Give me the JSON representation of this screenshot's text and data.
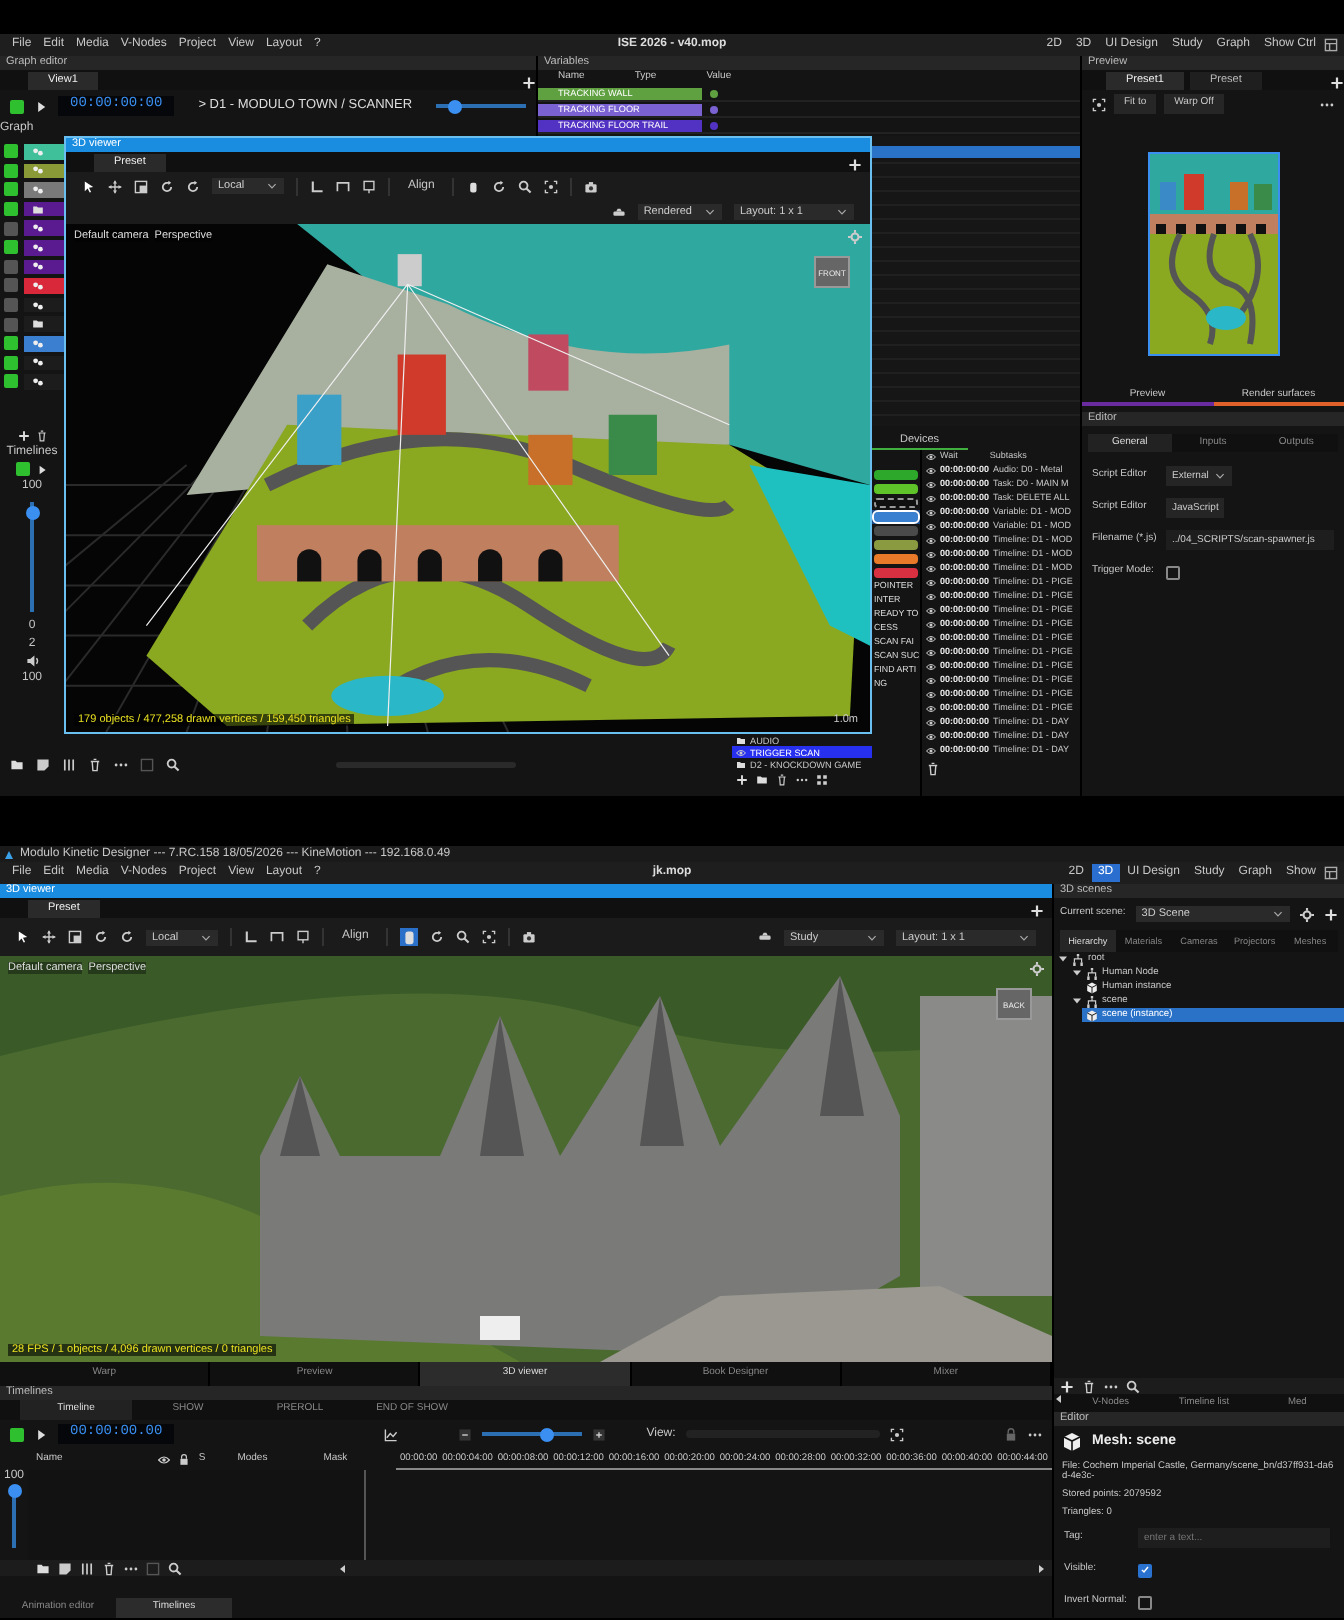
{
  "top": {
    "menu": [
      "File",
      "Edit",
      "Media",
      "V-Nodes",
      "Project",
      "View",
      "Layout",
      "?"
    ],
    "title": "ISE 2026 - v40.mop",
    "workspaces": [
      {
        "label": "2D",
        "selected": false
      },
      {
        "label": "3D",
        "selected": false
      },
      {
        "label": "UI Design",
        "selected": false
      },
      {
        "label": "Study",
        "selected": false
      },
      {
        "label": "Graph",
        "selected": false
      },
      {
        "label": "Show Ctrl",
        "selected": false
      }
    ],
    "graph_editor": {
      "title": "Graph editor",
      "tab": "View1",
      "timecode": "00:00:00:00",
      "path": "> D1 - MODULO TOWN / SCANNER",
      "zoom": {
        "level": 0.2
      },
      "label": "Graph",
      "rows": [
        {
          "kind": "node",
          "on": true,
          "color": "#3fbf9a"
        },
        {
          "kind": "node",
          "on": true,
          "color": "#8a9a36"
        },
        {
          "kind": "node",
          "on": true,
          "color": "#7a7a7a"
        },
        {
          "kind": "folder",
          "on": true,
          "color": "#5a1a90"
        },
        {
          "kind": "node",
          "on": false,
          "color": "#5a1a90"
        },
        {
          "kind": "node",
          "on": true,
          "color": "#5a1a90"
        },
        {
          "kind": "node",
          "on": false,
          "color": "#5a1a90"
        },
        {
          "kind": "node",
          "on": false,
          "color": "#d8283a"
        },
        {
          "kind": "node",
          "on": false,
          "color": "#1c1c1c"
        },
        {
          "kind": "folder",
          "on": false,
          "color": "#1c1c1c"
        },
        {
          "kind": "node",
          "on": true,
          "color": "#3a7fd0"
        },
        {
          "kind": "node",
          "on": true,
          "color": "#1c1c1c"
        },
        {
          "kind": "node",
          "on": true,
          "color": "#1c1c1c"
        }
      ]
    },
    "variables": {
      "title": "Variables",
      "columns": [
        "Name",
        "Type",
        "Value"
      ],
      "rows": [
        {
          "name": "TRACKING WALL",
          "color": "#5fa040"
        },
        {
          "name": "TRACKING FLOOR",
          "color": "#7a62d2"
        },
        {
          "name": "TRACKING FLOOR TRAIL",
          "color": "#5232c2"
        }
      ]
    },
    "viewer": {
      "title": "3D viewer",
      "tab": "Preset",
      "space": "Local",
      "align": "Align",
      "render_mode": "Rendered",
      "layout": "Layout: 1 x 1",
      "camera": "Default camera",
      "projection": "Perspective",
      "stats": "179 objects / 477,258 drawn vertices / 159,450 triangles",
      "scale": "1.0m",
      "gizmo": "FRONT"
    },
    "timelines": {
      "title": "Timelines",
      "volume": {
        "level": 0.9
      },
      "top_reading": "100",
      "readings": [
        "0",
        "2"
      ],
      "bottom_reading": "100"
    },
    "devices": {
      "tab": "Devices",
      "columns": [
        "Wait",
        "Subtasks"
      ],
      "tasks": [
        {
          "kind": "bar",
          "color": "#2ea82a",
          "selected": false
        },
        {
          "kind": "bar",
          "color": "#5ec42a",
          "selected": false
        },
        {
          "kind": "bar",
          "color": "#101010",
          "selected": false
        },
        {
          "kind": "bar",
          "color": "#3a80d0",
          "selected": true
        },
        {
          "kind": "bar",
          "color": "#4a4a4a",
          "selected": false
        },
        {
          "kind": "bar",
          "color": "#8a9a40",
          "selected": false
        },
        {
          "kind": "bar",
          "color": "#e87a2a",
          "selected": false
        },
        {
          "kind": "bar",
          "color": "#d83040",
          "selected": false
        },
        {
          "kind": "text",
          "label": "POINTER",
          "selected": false
        },
        {
          "kind": "text",
          "label": "INTER",
          "selected": false
        },
        {
          "kind": "text",
          "label": "READY TO",
          "selected": false
        },
        {
          "kind": "text",
          "label": "CESS",
          "selected": false
        },
        {
          "kind": "text",
          "label": "SCAN FAI",
          "selected": false
        },
        {
          "kind": "text",
          "label": "SCAN SUC",
          "selected": false
        },
        {
          "kind": "text",
          "label": "FIND ARTI",
          "selected": false
        },
        {
          "kind": "text",
          "label": "NG",
          "selected": false
        }
      ],
      "folders": [
        {
          "label": "AUDIO",
          "kind": "folder",
          "selected": false
        },
        {
          "label": "TRIGGER SCAN",
          "kind": "item",
          "selected": true
        },
        {
          "label": "D2 - KNOCKDOWN GAME",
          "kind": "folder",
          "selected": false
        }
      ],
      "subtasks": [
        {
          "wait": "00:00:00:00",
          "text": "Audio: D0 - Metal"
        },
        {
          "wait": "00:00:00:00",
          "text": "Task: D0 - MAIN M"
        },
        {
          "wait": "00:00:00:00",
          "text": "Task: DELETE ALL"
        },
        {
          "wait": "00:00:00:00",
          "text": "Variable: D1 - MOD"
        },
        {
          "wait": "00:00:00:00",
          "text": "Variable: D1 - MOD"
        },
        {
          "wait": "00:00:00:00",
          "text": "Timeline: D1 - MOD"
        },
        {
          "wait": "00:00:00:00",
          "text": "Timeline: D1 - MOD"
        },
        {
          "wait": "00:00:00:00",
          "text": "Timeline: D1 - MOD"
        },
        {
          "wait": "00:00:00:00",
          "text": "Timeline: D1 - PIGE"
        },
        {
          "wait": "00:00:00:00",
          "text": "Timeline: D1 - PIGE"
        },
        {
          "wait": "00:00:00:00",
          "text": "Timeline: D1 - PIGE"
        },
        {
          "wait": "00:00:00:00",
          "text": "Timeline: D1 - PIGE"
        },
        {
          "wait": "00:00:00:00",
          "text": "Timeline: D1 - PIGE"
        },
        {
          "wait": "00:00:00:00",
          "text": "Timeline: D1 - PIGE"
        },
        {
          "wait": "00:00:00:00",
          "text": "Timeline: D1 - PIGE"
        },
        {
          "wait": "00:00:00:00",
          "text": "Timeline: D1 - PIGE"
        },
        {
          "wait": "00:00:00:00",
          "text": "Timeline: D1 - PIGE"
        },
        {
          "wait": "00:00:00:00",
          "text": "Timeline: D1 - PIGE"
        },
        {
          "wait": "00:00:00:00",
          "text": "Timeline: D1 - DAY"
        },
        {
          "wait": "00:00:00:00",
          "text": "Timeline: D1 - DAY"
        },
        {
          "wait": "00:00:00:00",
          "text": "Timeline: D1 - DAY"
        }
      ]
    },
    "preview": {
      "title": "Preview",
      "tabs": [
        {
          "label": "Preset1",
          "selected": true
        },
        {
          "label": "Preset",
          "selected": false
        }
      ],
      "buttons": [
        "Fit to",
        "Warp Off"
      ],
      "views": [
        {
          "label": "Preview",
          "color": "#6a2aa0"
        },
        {
          "label": "Render surfaces",
          "color": "#e0602a"
        }
      ]
    },
    "editor": {
      "title": "Editor",
      "tabs": [
        {
          "label": "General",
          "selected": true
        },
        {
          "label": "Inputs",
          "selected": false
        },
        {
          "label": "Outputs",
          "selected": false
        }
      ],
      "fields": [
        {
          "kind": "dropdown",
          "label": "Script Editor",
          "value": "External"
        },
        {
          "kind": "button",
          "label": "Script Editor",
          "value": "JavaScript"
        },
        {
          "kind": "text",
          "label": "Filename (*.js)",
          "value": "../04_SCRIPTS/scan-spawner.js"
        },
        {
          "kind": "checkbox",
          "label": "Trigger Mode:",
          "checked": false
        }
      ]
    }
  },
  "bottom": {
    "app_title": "Modulo Kinetic Designer --- 7.RC.158 18/05/2026 --- KineMotion --- 192.168.0.49",
    "menu": [
      "File",
      "Edit",
      "Media",
      "V-Nodes",
      "Project",
      "View",
      "Layout",
      "?"
    ],
    "title": "jk.mop",
    "workspaces": [
      {
        "label": "2D",
        "selected": false
      },
      {
        "label": "3D",
        "selected": true
      },
      {
        "label": "UI Design",
        "selected": false
      },
      {
        "label": "Study",
        "selected": false
      },
      {
        "label": "Graph",
        "selected": false
      },
      {
        "label": "Show",
        "selected": false
      }
    ],
    "viewer": {
      "title": "3D viewer",
      "tab": "Preset",
      "space": "Local",
      "align": "Align",
      "render_mode": "Study",
      "layout": "Layout: 1 x 1",
      "camera": "Default camera",
      "projection": "Perspective",
      "stats": "28 FPS / 1 objects / 4,096 drawn vertices / 0 triangles",
      "gizmo": "BACK"
    },
    "panel_tabs": [
      {
        "label": "Warp",
        "selected": false
      },
      {
        "label": "Preview",
        "selected": false
      },
      {
        "label": "3D viewer",
        "selected": true
      },
      {
        "label": "Book Designer",
        "selected": false
      },
      {
        "label": "Mixer",
        "selected": false
      }
    ],
    "timelines": {
      "title": "Timelines",
      "tabs": [
        {
          "label": "Timeline",
          "selected": true
        },
        {
          "label": "SHOW",
          "selected": false
        },
        {
          "label": "PREROLL",
          "selected": false
        },
        {
          "label": "END OF SHOW",
          "selected": false
        }
      ],
      "timecode": "00:00:00.00",
      "zoom": {
        "level": 0.65
      },
      "view": "View:",
      "columns": [
        "Name",
        "S",
        "Modes",
        "Mask"
      ],
      "ticks": [
        "00:00:00",
        "00:00:04:00",
        "00:00:08:00",
        "00:00:12:00",
        "00:00:16:00",
        "00:00:20:00",
        "00:00:24:00",
        "00:00:28:00",
        "00:00:32:00",
        "00:00:36:00",
        "00:00:40:00",
        "00:00:44:00"
      ],
      "volume": {
        "level": 0.95
      },
      "reading": "100"
    },
    "bottom_tabs": [
      {
        "label": "Animation editor",
        "selected": false
      },
      {
        "label": "Timelines",
        "selected": true
      }
    ],
    "scenes": {
      "title": "3D scenes",
      "current_label": "Current scene:",
      "current": "3D Scene",
      "tabs": [
        {
          "label": "Hierarchy",
          "selected": true
        },
        {
          "label": "Materials",
          "selected": false
        },
        {
          "label": "Cameras",
          "selected": false
        },
        {
          "label": "Projectors",
          "selected": false
        },
        {
          "label": "Meshes",
          "selected": false
        }
      ],
      "tree": [
        {
          "label": "root",
          "kind": "group",
          "expanded": true,
          "selected": false,
          "children": [
            {
              "label": "Human Node",
              "kind": "group",
              "expanded": true,
              "selected": false,
              "children": [
                {
                  "label": "Human instance",
                  "kind": "instance",
                  "selected": false
                }
              ]
            },
            {
              "label": "scene",
              "kind": "group",
              "expanded": true,
              "selected": false,
              "children": [
                {
                  "label": "scene (instance)",
                  "kind": "instance",
                  "selected": true
                }
              ]
            }
          ]
        }
      ]
    },
    "list_tabs": [
      {
        "label": "V-Nodes",
        "selected": false
      },
      {
        "label": "Timeline list",
        "selected": false
      },
      {
        "label": "Med",
        "selected": false
      }
    ],
    "editor": {
      "title": "Editor",
      "heading": "Mesh: scene",
      "info": [
        "File: Cochem Imperial Castle, Germany/scene_bn/d37ff931-da6d-4e3c-",
        "Stored points: 2079592",
        "Triangles: 0"
      ],
      "fields": [
        {
          "kind": "text",
          "label": "Tag:",
          "placeholder": "enter a text..."
        },
        {
          "kind": "checkbox",
          "label": "Visible:",
          "checked": true
        },
        {
          "kind": "checkbox",
          "label": "Invert Normal:",
          "checked": false
        }
      ]
    }
  }
}
